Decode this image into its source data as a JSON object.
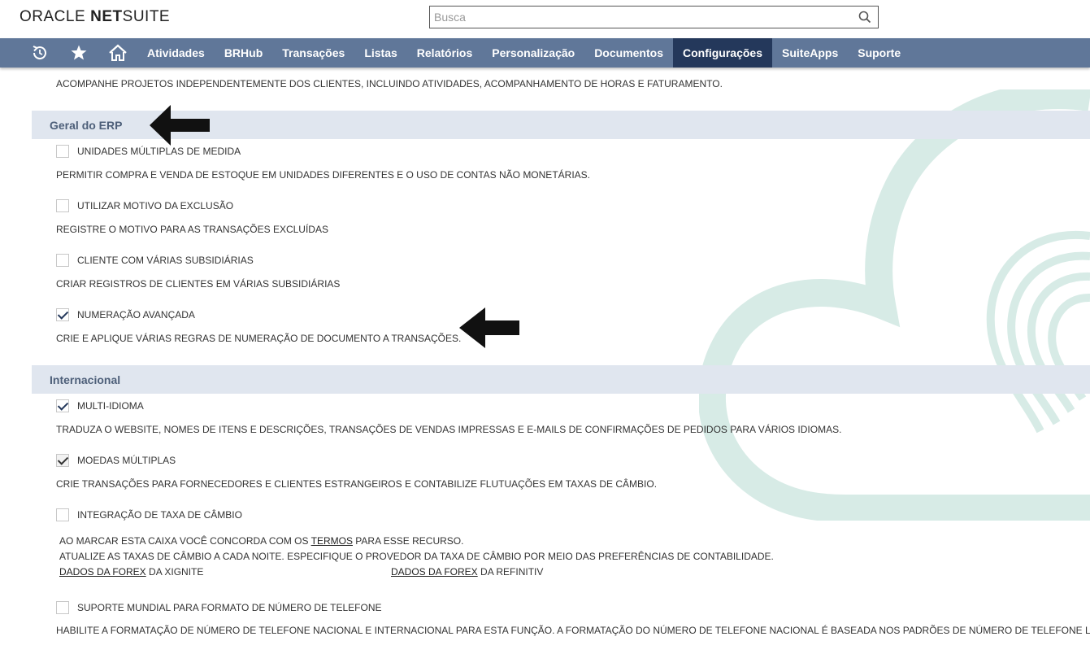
{
  "header": {
    "logo_oracle": "ORACLE",
    "logo_net": "NET",
    "logo_suite": "SUITE",
    "search_placeholder": "Busca"
  },
  "nav": {
    "icons": [
      "recent-icon",
      "star-icon",
      "home-icon"
    ],
    "items": [
      "Atividades",
      "BRHub",
      "Transações",
      "Listas",
      "Relatórios",
      "Personalização",
      "Documentos",
      "Configurações",
      "SuiteApps",
      "Suporte"
    ],
    "active": "Configurações",
    "bar_color": "#607799",
    "active_color": "#24385b"
  },
  "top_desc": "ACOMPANHE PROJETOS INDEPENDENTEMENTE DOS CLIENTES, INCLUINDO ATIVIDADES, ACOMPANHAMENTO DE HORAS E FATURAMENTO.",
  "sections": [
    {
      "title": "Geral do ERP",
      "features": [
        {
          "label": "UNIDADES MÚLTIPLAS DE MEDIDA",
          "checked": false,
          "desc": "PERMITIR COMPRA E VENDA DE ESTOQUE EM UNIDADES DIFERENTES E O USO DE CONTAS NÃO MONETÁRIAS."
        },
        {
          "label": "UTILIZAR MOTIVO DA EXCLUSÃO",
          "checked": false,
          "desc": "REGISTRE O MOTIVO PARA AS TRANSAÇÕES EXCLUÍDAS"
        },
        {
          "label": "CLIENTE COM VÁRIAS SUBSIDIÁRIAS",
          "checked": false,
          "desc": "CRIAR REGISTROS DE CLIENTES EM VÁRIAS SUBSIDIÁRIAS"
        },
        {
          "label": "NUMERAÇÃO AVANÇADA",
          "checked": true,
          "desc": "CRIE E APLIQUE VÁRIAS REGRAS DE NUMERAÇÃO DE DOCUMENTO A TRANSAÇÕES."
        }
      ]
    },
    {
      "title": "Internacional",
      "features": [
        {
          "label": "MULTI-IDIOMA",
          "checked": true,
          "desc": "TRADUZA O WEBSITE, NOMES DE ITENS E DESCRIÇÕES, TRANSAÇÕES DE VENDAS IMPRESSAS E E-MAILS DE CONFIRMAÇÕES DE PEDIDOS PARA VÁRIOS IDIOMAS."
        },
        {
          "label": "MOEDAS MÚLTIPLAS",
          "checked": true,
          "desc": "CRIE TRANSAÇÕES PARA FORNECEDORES E CLIENTES ESTRANGEIROS E CONTABILIZE FLUTUAÇÕES EM TAXAS DE CÂMBIO."
        },
        {
          "label": "INTEGRAÇÃO DE TAXA DE CÂMBIO",
          "checked": false,
          "line1_pre": "AO MARCAR ESTA CAIXA VOCÊ CONCORDA COM OS ",
          "line1_link": "TERMOS",
          "line1_post": " PARA ESSE RECURSO.",
          "line2": "ATUALIZE AS TAXAS DE CÂMBIO A CADA NOITE. ESPECIFIQUE O PROVEDOR DA TAXA DE CÂMBIO POR MEIO DAS PREFERÊNCIAS DE CONTABILIDADE.",
          "forex1_link": "DADOS DA FOREX",
          "forex1_post": " DA XIGNITE",
          "forex2_link": "DADOS DA FOREX",
          "forex2_post": " DA REFINITIV"
        },
        {
          "label": "SUPORTE MUNDIAL PARA FORMATO DE NÚMERO DE TELEFONE",
          "checked": false,
          "desc": "HABILITE A FORMATAÇÃO DE NÚMERO DE TELEFONE NACIONAL E INTERNACIONAL PARA ESTA FUNÇÃO. A FORMATAÇÃO DO NÚMERO DE TELEFONE NACIONAL É BASEADA NOS PADRÕES DE NÚMERO DE TELEFONE LOCAIS."
        }
      ]
    }
  ],
  "annotations": [
    "arrow-icon",
    "arrow-icon"
  ]
}
